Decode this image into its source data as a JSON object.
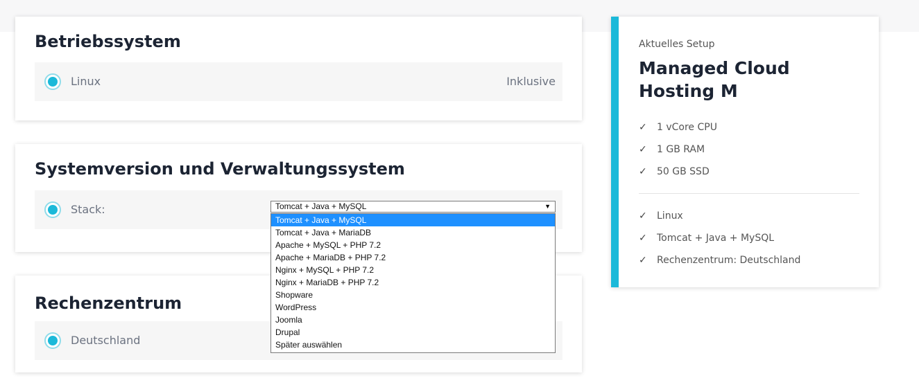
{
  "sections": {
    "os": {
      "title": "Betriebssystem",
      "option_label": "Linux",
      "option_price": "Inklusive"
    },
    "version": {
      "title": "Systemversion und Verwaltungssystem",
      "option_label": "Stack:",
      "select_value": "Tomcat + Java + MySQL",
      "options": [
        "Tomcat + Java + MySQL",
        "Tomcat + Java + MariaDB",
        "Apache + MySQL + PHP 7.2",
        "Apache + MariaDB + PHP 7.2",
        "Nginx + MySQL + PHP 7.2",
        "Nginx + MariaDB + PHP 7.2",
        "Shopware",
        "WordPress",
        "Joomla",
        "Drupal",
        "Später auswählen"
      ]
    },
    "datacenter": {
      "title": "Rechenzentrum",
      "option_label": "Deutschland"
    }
  },
  "sidebar": {
    "subtitle": "Aktuelles Setup",
    "title": "Managed Cloud Hosting M",
    "specs": [
      "1 vCore CPU",
      "1 GB RAM",
      "50 GB SSD"
    ],
    "choices": [
      "Linux",
      "Tomcat + Java + MySQL",
      "Rechenzentrum: Deutschland"
    ],
    "check_glyph": "✓"
  },
  "colors": {
    "accent": "#1bb9d9",
    "selected_option_bg": "#1e90ff"
  }
}
